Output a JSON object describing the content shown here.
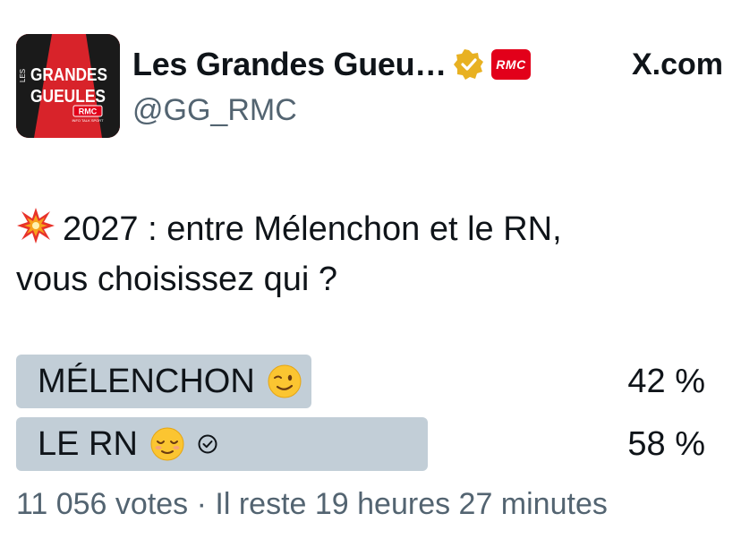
{
  "account": {
    "display_name": "Les Grandes Gueu…",
    "handle": "@GG_RMC",
    "affiliate_badge": "RMC",
    "source": "X.com",
    "avatar_text": {
      "line1": "GRANDES",
      "line2": "GUEULES",
      "small": "LES",
      "brand": "RMC",
      "tagline": "INFO TALK SPORT"
    }
  },
  "tweet": {
    "text_line1": "2027 : entre Mélenchon et le RN,",
    "text_line2": "vous choisissez qui ?"
  },
  "poll": {
    "options": [
      {
        "label": "MÉLENCHON",
        "percent_text": "42 %",
        "percent": 42,
        "emoji": "winking-face",
        "selected": false
      },
      {
        "label": "LE RN",
        "percent_text": "58 %",
        "percent": 58,
        "emoji": "relieved-face",
        "selected": true
      }
    ],
    "meta": "11 056 votes · Il reste 19 heures 27 minutes"
  },
  "colors": {
    "bar": "#c2ced7",
    "verified": "#e8b122",
    "rmc_red": "#e2001a",
    "muted_text": "#536471"
  }
}
